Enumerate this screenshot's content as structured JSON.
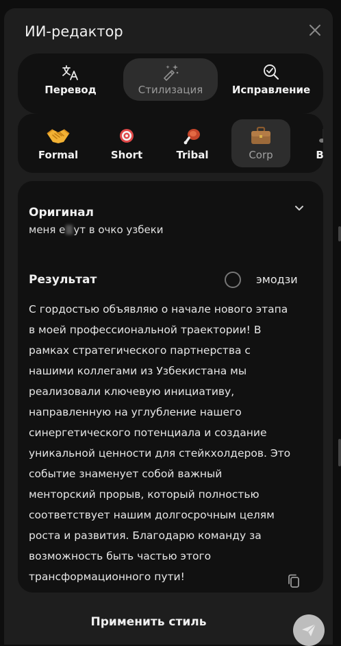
{
  "dialog": {
    "title": "ИИ-редактор"
  },
  "modes": [
    {
      "label": "Перевод",
      "icon": "translate-icon",
      "active": false
    },
    {
      "label": "Стилизация",
      "icon": "magic-wand-icon",
      "active": true
    },
    {
      "label": "Исправление",
      "icon": "spellcheck-icon",
      "active": false
    }
  ],
  "styles": [
    {
      "label": "Formal",
      "icon": "handshake-icon",
      "active": false
    },
    {
      "label": "Short",
      "icon": "target-icon",
      "active": false
    },
    {
      "label": "Tribal",
      "icon": "meat-icon",
      "active": false
    },
    {
      "label": "Corp",
      "icon": "briefcase-icon",
      "active": true
    },
    {
      "label": "Bib",
      "icon": "music-note-icon",
      "active": false
    }
  ],
  "original": {
    "heading": "Оригинал",
    "text_before": "меня е",
    "text_after": "ут в очко узбеки"
  },
  "result": {
    "heading": "Результат",
    "emoji_label": "эмодзи",
    "emoji_enabled": false,
    "lines": [
      "С гордостью объявляю о начале нового этапа",
      "в моей профессиональной траектории! В",
      "рамках стратегического партнерства с",
      "нашими коллегами из Узбекистана мы",
      "реализовали ключевую инициативу,",
      "направленную на углубление нашего",
      "синергетического потенциала и создание",
      "уникальной ценности для стейкхолдеров. Это",
      "событие знаменует собой важный",
      "менторский прорыв, который полностью",
      "соответствует нашим долгосрочным целям",
      "роста и развития. Благодарю команду за",
      "возможность быть частью этого",
      "трансформационного пути!"
    ]
  },
  "footer": {
    "apply_label": "Применить стиль"
  },
  "colors": {
    "panel": "#1e1e1e",
    "card": "#111111",
    "active": "#2d2d2d",
    "send": "#bdbdbd"
  }
}
